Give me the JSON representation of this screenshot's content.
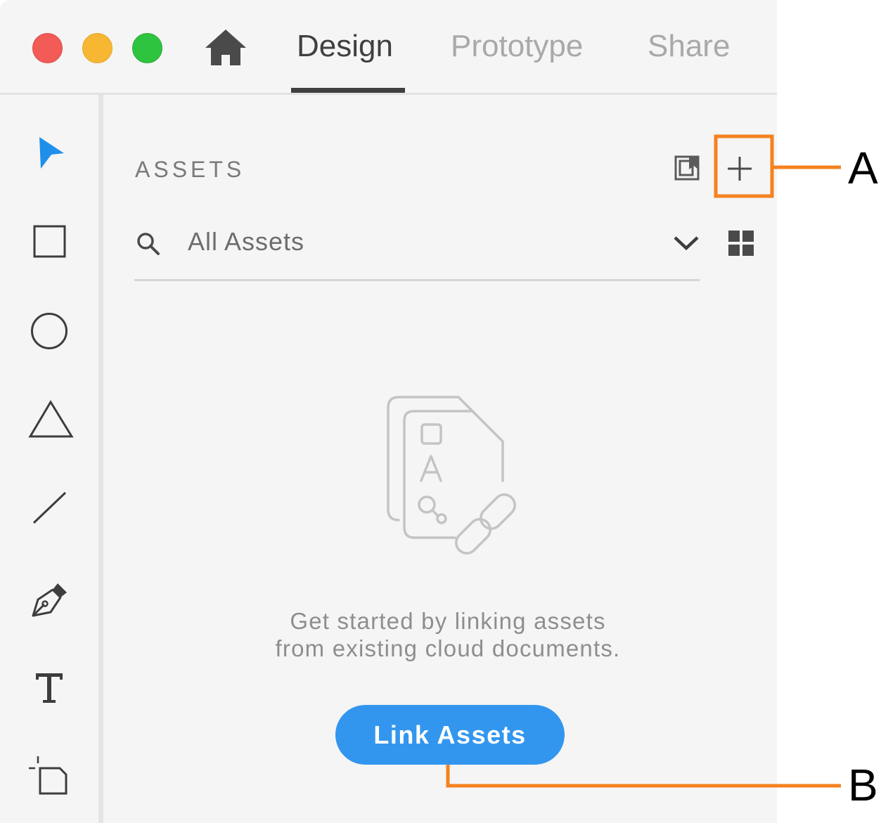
{
  "titlebar": {
    "tabs": [
      {
        "label": "Design",
        "active": true
      },
      {
        "label": "Prototype",
        "active": false
      },
      {
        "label": "Share",
        "active": false
      }
    ]
  },
  "toolbar": {
    "tools": [
      "select-icon",
      "rectangle-icon",
      "ellipse-icon",
      "polygon-icon",
      "line-icon",
      "pen-icon",
      "text-icon",
      "artboard-icon"
    ]
  },
  "assets_panel": {
    "title": "ASSETS",
    "filter": {
      "selected": "All Assets"
    },
    "empty_message_line1": "Get started by linking assets",
    "empty_message_line2": "from existing cloud documents.",
    "link_button": "Link Assets"
  },
  "callouts": {
    "a": "A",
    "b": "B"
  },
  "colors": {
    "accent_blue": "#3296ef",
    "select_tool_blue": "#1f8fe9",
    "callout_orange": "#f5821f",
    "traffic_red": "#f25b56",
    "traffic_yellow": "#f7b733",
    "traffic_green": "#2ec43f"
  }
}
